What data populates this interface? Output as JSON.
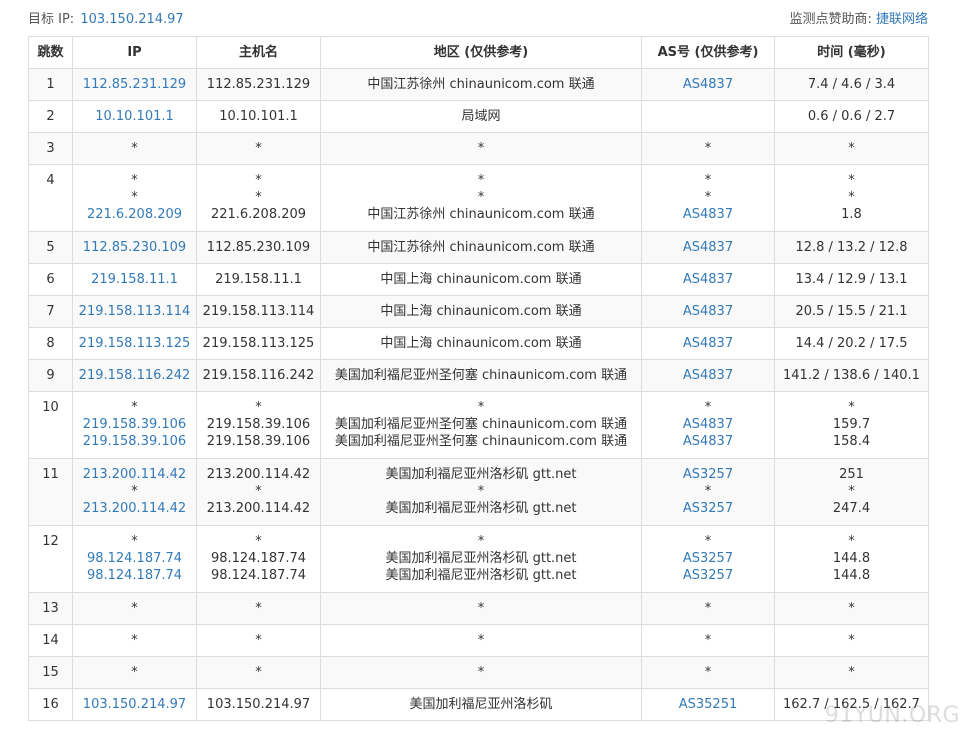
{
  "header": {
    "target_label": "目标 IP:",
    "target_ip": "103.150.214.97",
    "sponsor_label": "监测点赞助商:",
    "sponsor_name": "捷联网络"
  },
  "columns": [
    "跳数",
    "IP",
    "主机名",
    "地区 (仅供参考)",
    "AS号 (仅供参考)",
    "时间 (毫秒)"
  ],
  "rows": [
    {
      "hop": "1",
      "lines": [
        {
          "ip": "112.85.231.129",
          "host": "112.85.231.129",
          "region": "中国江苏徐州 chinaunicom.com 联通",
          "as": "AS4837",
          "time": "7.4 / 4.6 / 3.4"
        }
      ]
    },
    {
      "hop": "2",
      "lines": [
        {
          "ip": "10.10.101.1",
          "host": "10.10.101.1",
          "region": "局域网",
          "as": "",
          "time": "0.6 / 0.6 / 2.7"
        }
      ]
    },
    {
      "hop": "3",
      "lines": [
        {
          "ip": "*",
          "host": "*",
          "region": "*",
          "as": "*",
          "time": "*"
        }
      ]
    },
    {
      "hop": "4",
      "lines": [
        {
          "ip": "*",
          "host": "*",
          "region": "*",
          "as": "*",
          "time": "*"
        },
        {
          "ip": "*",
          "host": "*",
          "region": "*",
          "as": "*",
          "time": "*"
        },
        {
          "ip": "221.6.208.209",
          "host": "221.6.208.209",
          "region": "中国江苏徐州 chinaunicom.com 联通",
          "as": "AS4837",
          "time": "1.8"
        }
      ]
    },
    {
      "hop": "5",
      "lines": [
        {
          "ip": "112.85.230.109",
          "host": "112.85.230.109",
          "region": "中国江苏徐州 chinaunicom.com 联通",
          "as": "AS4837",
          "time": "12.8 / 13.2 / 12.8"
        }
      ]
    },
    {
      "hop": "6",
      "lines": [
        {
          "ip": "219.158.11.1",
          "host": "219.158.11.1",
          "region": "中国上海 chinaunicom.com 联通",
          "as": "AS4837",
          "time": "13.4 / 12.9 / 13.1"
        }
      ]
    },
    {
      "hop": "7",
      "lines": [
        {
          "ip": "219.158.113.114",
          "host": "219.158.113.114",
          "region": "中国上海 chinaunicom.com 联通",
          "as": "AS4837",
          "time": "20.5 / 15.5 / 21.1"
        }
      ]
    },
    {
      "hop": "8",
      "lines": [
        {
          "ip": "219.158.113.125",
          "host": "219.158.113.125",
          "region": "中国上海 chinaunicom.com 联通",
          "as": "AS4837",
          "time": "14.4 / 20.2 / 17.5"
        }
      ]
    },
    {
      "hop": "9",
      "lines": [
        {
          "ip": "219.158.116.242",
          "host": "219.158.116.242",
          "region": "美国加利福尼亚州圣何塞 chinaunicom.com 联通",
          "as": "AS4837",
          "time": "141.2 / 138.6 / 140.1"
        }
      ]
    },
    {
      "hop": "10",
      "lines": [
        {
          "ip": "*",
          "host": "*",
          "region": "*",
          "as": "*",
          "time": "*"
        },
        {
          "ip": "219.158.39.106",
          "host": "219.158.39.106",
          "region": "美国加利福尼亚州圣何塞 chinaunicom.com 联通",
          "as": "AS4837",
          "time": "159.7"
        },
        {
          "ip": "219.158.39.106",
          "host": "219.158.39.106",
          "region": "美国加利福尼亚州圣何塞 chinaunicom.com 联通",
          "as": "AS4837",
          "time": "158.4"
        }
      ]
    },
    {
      "hop": "11",
      "lines": [
        {
          "ip": "213.200.114.42",
          "host": "213.200.114.42",
          "region": "美国加利福尼亚州洛杉矶 gtt.net",
          "as": "AS3257",
          "time": "251"
        },
        {
          "ip": "*",
          "host": "*",
          "region": "*",
          "as": "*",
          "time": "*"
        },
        {
          "ip": "213.200.114.42",
          "host": "213.200.114.42",
          "region": "美国加利福尼亚州洛杉矶 gtt.net",
          "as": "AS3257",
          "time": "247.4"
        }
      ]
    },
    {
      "hop": "12",
      "lines": [
        {
          "ip": "*",
          "host": "*",
          "region": "*",
          "as": "*",
          "time": "*"
        },
        {
          "ip": "98.124.187.74",
          "host": "98.124.187.74",
          "region": "美国加利福尼亚州洛杉矶 gtt.net",
          "as": "AS3257",
          "time": "144.8"
        },
        {
          "ip": "98.124.187.74",
          "host": "98.124.187.74",
          "region": "美国加利福尼亚州洛杉矶 gtt.net",
          "as": "AS3257",
          "time": "144.8"
        }
      ]
    },
    {
      "hop": "13",
      "lines": [
        {
          "ip": "*",
          "host": "*",
          "region": "*",
          "as": "*",
          "time": "*"
        }
      ]
    },
    {
      "hop": "14",
      "lines": [
        {
          "ip": "*",
          "host": "*",
          "region": "*",
          "as": "*",
          "time": "*"
        }
      ]
    },
    {
      "hop": "15",
      "lines": [
        {
          "ip": "*",
          "host": "*",
          "region": "*",
          "as": "*",
          "time": "*"
        }
      ]
    },
    {
      "hop": "16",
      "lines": [
        {
          "ip": "103.150.214.97",
          "host": "103.150.214.97",
          "region": "美国加利福尼亚州洛杉矶",
          "as": "AS35251",
          "time": "162.7 / 162.5 / 162.7"
        }
      ]
    }
  ],
  "watermark": "91YUN.ORG",
  "colors": {
    "link": "#337ab7",
    "border": "#dddddd",
    "stripe": "#f9f9f9"
  }
}
